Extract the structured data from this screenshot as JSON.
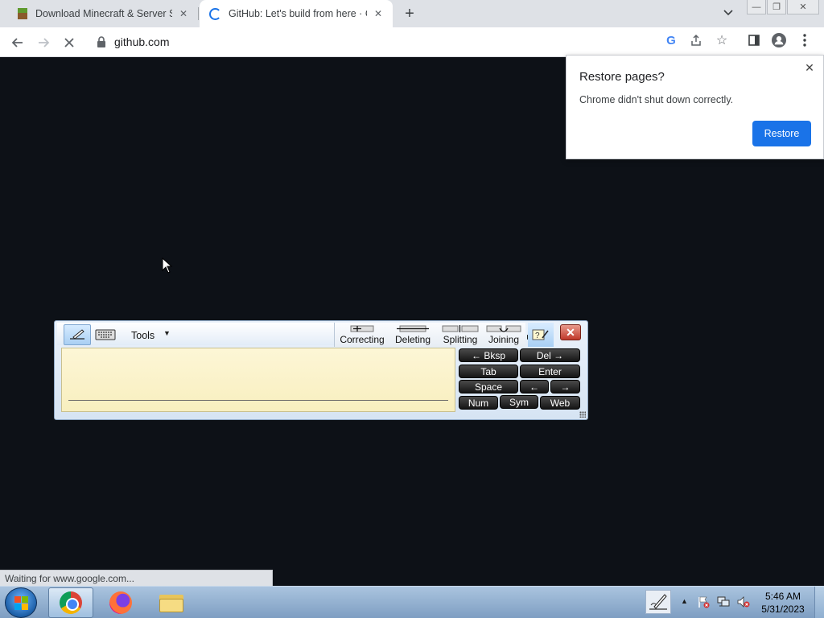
{
  "tabs": [
    {
      "title": "Download Minecraft & Server Software",
      "close": "✕"
    },
    {
      "title": "GitHub: Let's build from here · GitHub",
      "close": "✕"
    }
  ],
  "tabstrip": {
    "new_tab": "+",
    "tab_search": "⌄",
    "minimize": "—",
    "maximize": "❐",
    "close": "✕"
  },
  "toolbar": {
    "back": "←",
    "forward": "→",
    "reload": "✕",
    "url": "github.com",
    "google_icon": "G",
    "share": "⇪",
    "bookmark": "☆",
    "side_panel": "▯",
    "profile": "●",
    "menu": "⋮"
  },
  "restore_bubble": {
    "title": "Restore pages?",
    "message": "Chrome didn't shut down correctly.",
    "restore_label": "Restore",
    "close": "✕"
  },
  "input_panel": {
    "tools_label": "Tools",
    "tools_arrow": "▼",
    "gestures": [
      "Correcting",
      "Deleting",
      "Splitting",
      "Joining"
    ],
    "more": "▶",
    "help": "?",
    "close": "✕",
    "keys": {
      "bksp": "←   Bksp",
      "del": "Del   →",
      "tab": "Tab",
      "enter": "Enter",
      "space": "Space",
      "left": "←",
      "right": "→",
      "num": "Num",
      "sym": "Sym",
      "web": "Web"
    }
  },
  "status_text": "Waiting for www.google.com...",
  "taskbar": {
    "time": "5:46 AM",
    "date": "5/31/2023",
    "tray_arrow": "▲"
  },
  "colors": {
    "page_bg": "#0d1117",
    "accent": "#1a73e8",
    "tabstrip": "#dee1e6"
  }
}
